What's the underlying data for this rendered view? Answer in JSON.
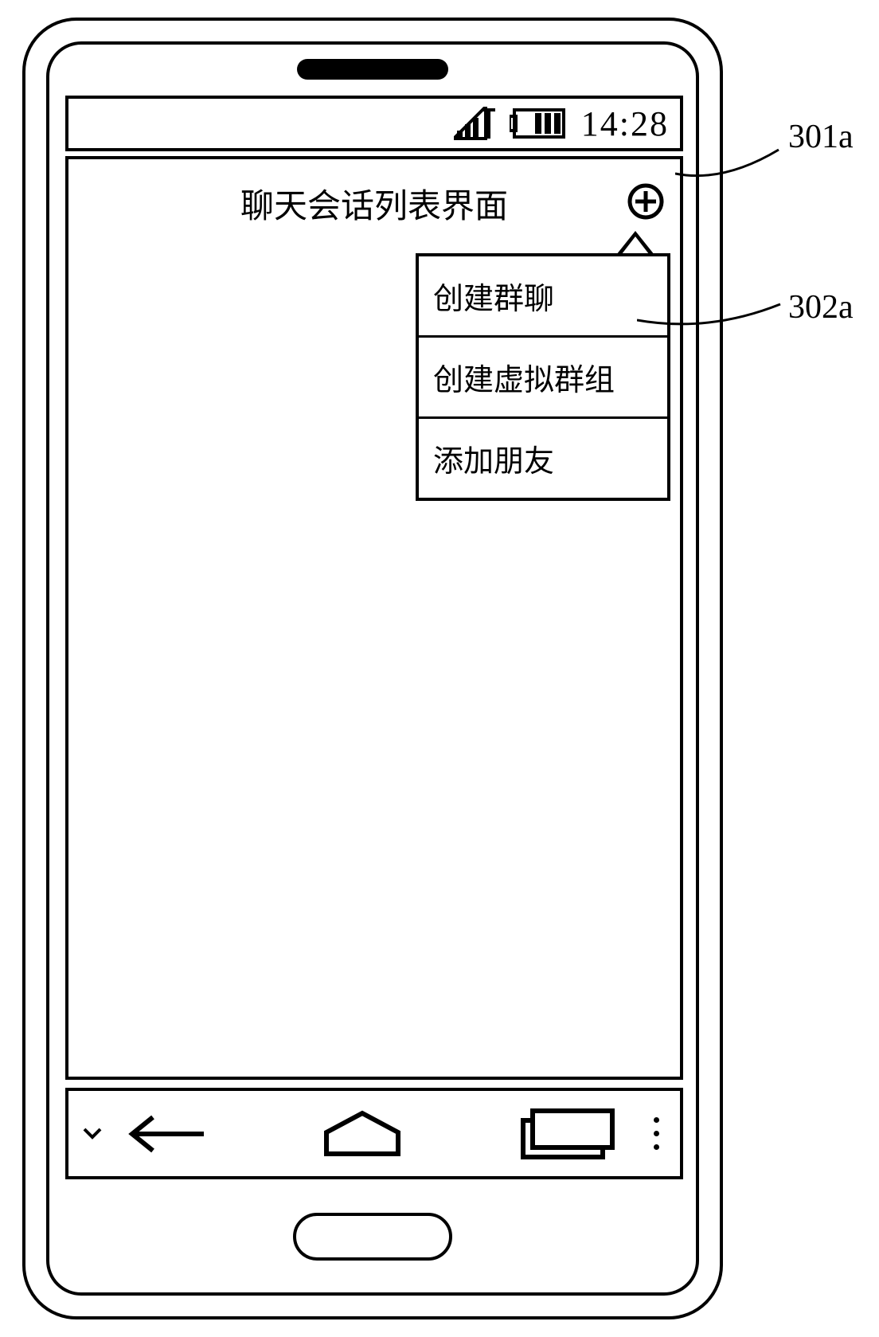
{
  "status_bar": {
    "time": "14:28"
  },
  "header": {
    "title": "聊天会话列表界面"
  },
  "dropdown": {
    "items": [
      {
        "label": "创建群聊"
      },
      {
        "label": "创建虚拟群组"
      },
      {
        "label": "添加朋友"
      }
    ]
  },
  "callouts": {
    "ref_301": "301a",
    "ref_302": "302a"
  }
}
